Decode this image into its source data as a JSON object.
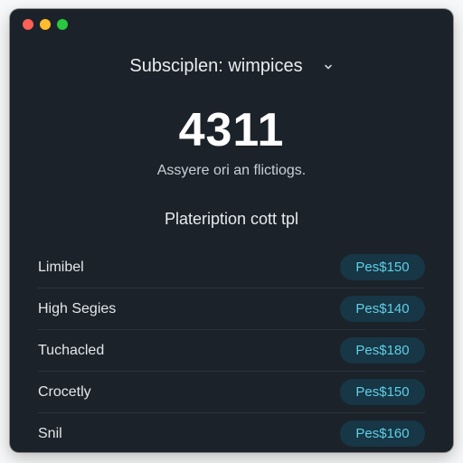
{
  "window": {
    "controls": [
      "close",
      "minimize",
      "maximize"
    ]
  },
  "header": {
    "title": "Subsciplen: wimpices",
    "dropdown_icon": "chevron-down-icon"
  },
  "summary": {
    "value": "4311",
    "caption": "Assyere ori an flictiogs."
  },
  "section": {
    "title": "Plateription cott tpl"
  },
  "items": [
    {
      "label": "Limibel",
      "price": "Pes$150"
    },
    {
      "label": "High Segies",
      "price": "Pes$140"
    },
    {
      "label": "Tuchacled",
      "price": "Pes$180"
    },
    {
      "label": "Crocetly",
      "price": "Pes$150"
    },
    {
      "label": "Snil",
      "price": "Pes$160"
    }
  ],
  "colors": {
    "window_bg": "#1b2229",
    "accent": "#5fd0e4",
    "pill_bg": "#173646"
  }
}
